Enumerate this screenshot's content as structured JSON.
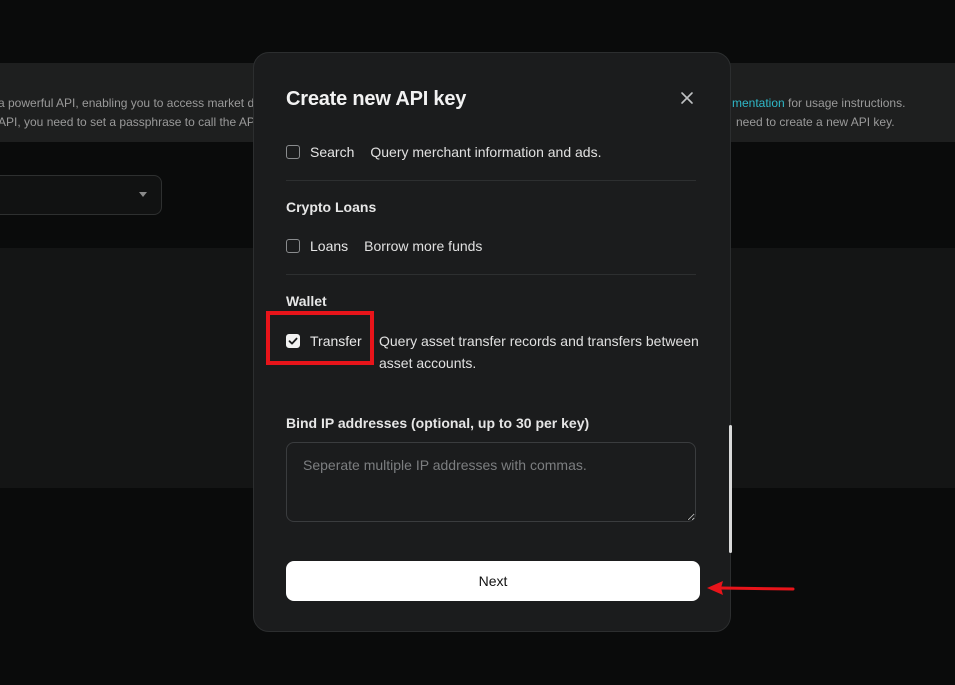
{
  "background": {
    "banner_line1_left": "a powerful API, enabling you to access market d",
    "banner_line2_left": "API, you need to set a passphrase to call the API",
    "banner_link": "mentation",
    "banner_line1_right": " for usage instructions.",
    "banner_line2_right": "need to create a new API key."
  },
  "modal": {
    "title": "Create new API key",
    "close_icon": "close-icon",
    "permissions_top": [
      {
        "name": "Search",
        "description": "Query merchant information and ads.",
        "checked": false
      }
    ],
    "sections": [
      {
        "title": "Crypto Loans",
        "items": [
          {
            "name": "Loans",
            "description": "Borrow more funds",
            "checked": false
          }
        ]
      },
      {
        "title": "Wallet",
        "items": [
          {
            "name": "Transfer",
            "description": "Query asset transfer records and transfers between asset accounts.",
            "checked": true
          }
        ]
      }
    ],
    "ip": {
      "label": "Bind IP addresses (optional, up to 30 per key)",
      "placeholder": "Seperate multiple IP addresses with commas.",
      "value": ""
    },
    "next_label": "Next"
  },
  "annotations": {
    "highlight_color": "#e8141a",
    "arrow_color": "#e8141a"
  }
}
